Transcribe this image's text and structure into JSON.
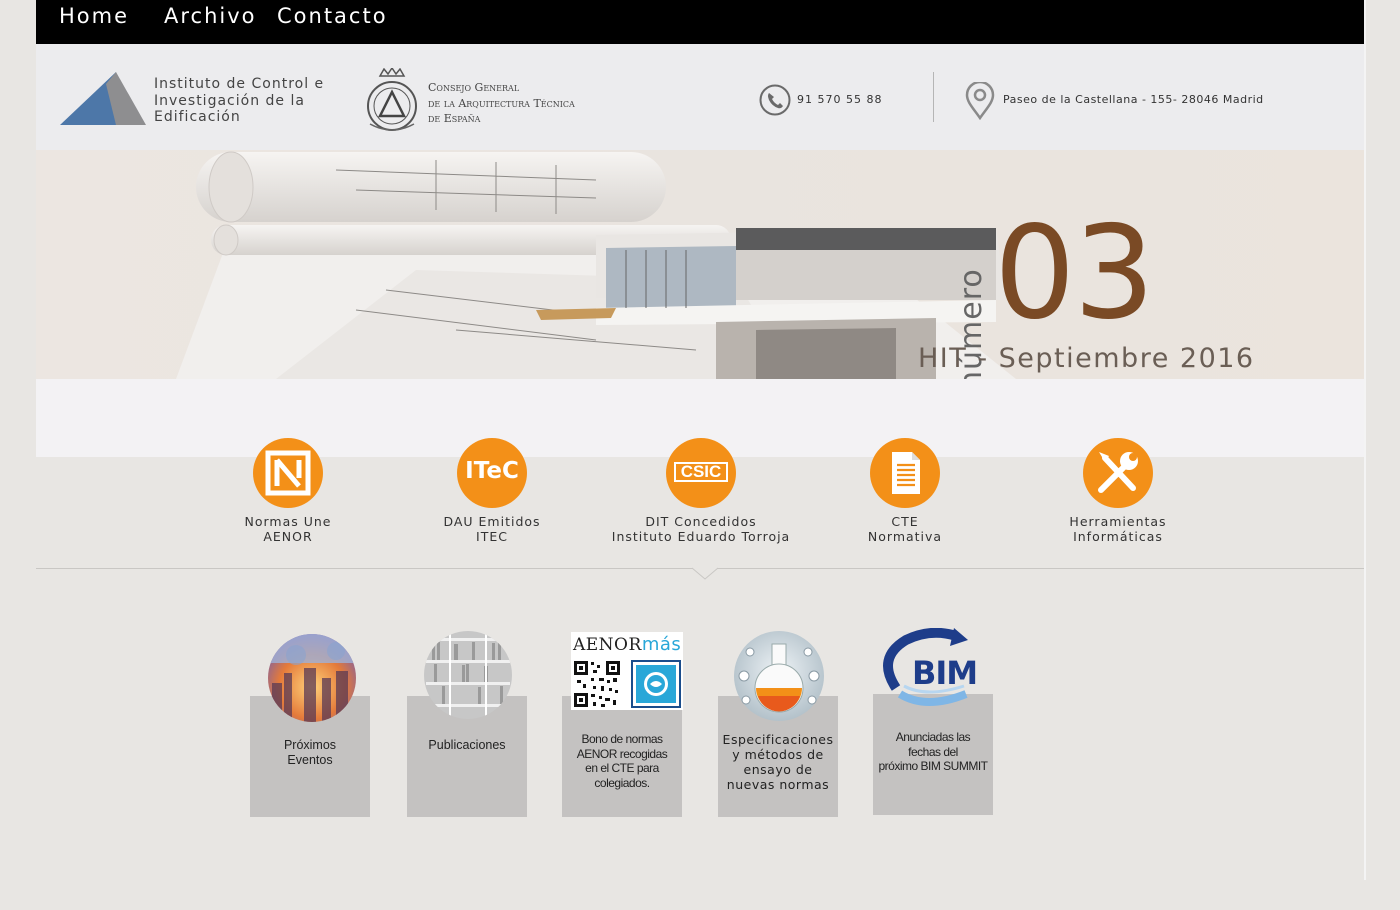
{
  "nav": {
    "items": [
      {
        "label": "Home"
      },
      {
        "label": "Archivo"
      },
      {
        "label": "Contacto"
      }
    ]
  },
  "header": {
    "institute_line1": "Instituto de Control e",
    "institute_line2": "Investigación de la",
    "institute_line3": "Edificación",
    "council_line1": "Consejo General",
    "council_line2": "de la Arquitectura Técnica",
    "council_line3": "de España",
    "phone": "91 570 55 88",
    "address": "Paseo de la Castellana - 155- 28046 Madrid"
  },
  "banner": {
    "issue_word": "número",
    "issue_number": "03",
    "issue_title": "HIT - Septiembre 2016"
  },
  "categories": [
    {
      "line1": "Normas Une",
      "line2": "AENOR",
      "icon": "aenor-logo-icon",
      "badge": ""
    },
    {
      "line1": "DAU Emitidos",
      "line2": "ITEC",
      "icon": "itec-logo-icon",
      "badge": "ITeC"
    },
    {
      "line1": "DIT Concedidos",
      "line2": "Instituto Eduardo Torroja",
      "icon": "csic-logo-icon",
      "badge": "CSIC"
    },
    {
      "line1": "CTE",
      "line2": "Normativa",
      "icon": "document-icon",
      "badge": ""
    },
    {
      "line1": "Herramientas",
      "line2": "Informáticas",
      "icon": "tools-icon",
      "badge": ""
    }
  ],
  "cards": [
    {
      "lines": [
        "Próximos",
        "Eventos"
      ]
    },
    {
      "lines": [
        "Publicaciones"
      ]
    },
    {
      "lines": [
        "Bono de normas",
        "AENOR recogidas",
        "en el CTE para",
        "colegiados."
      ],
      "badge_main": "AENOR",
      "badge_accent": "más"
    },
    {
      "lines": [
        "Especificaciones",
        "y métodos de",
        "ensayo de",
        "nuevas normas"
      ]
    },
    {
      "lines": [
        "Anunciadas las",
        "fechas del",
        "próximo BIM SUMMIT"
      ],
      "badge_main": "BIM"
    }
  ],
  "colors": {
    "accent_orange": "#f39018",
    "issue_brown": "#7a4a25",
    "nav_bg": "#000000"
  }
}
